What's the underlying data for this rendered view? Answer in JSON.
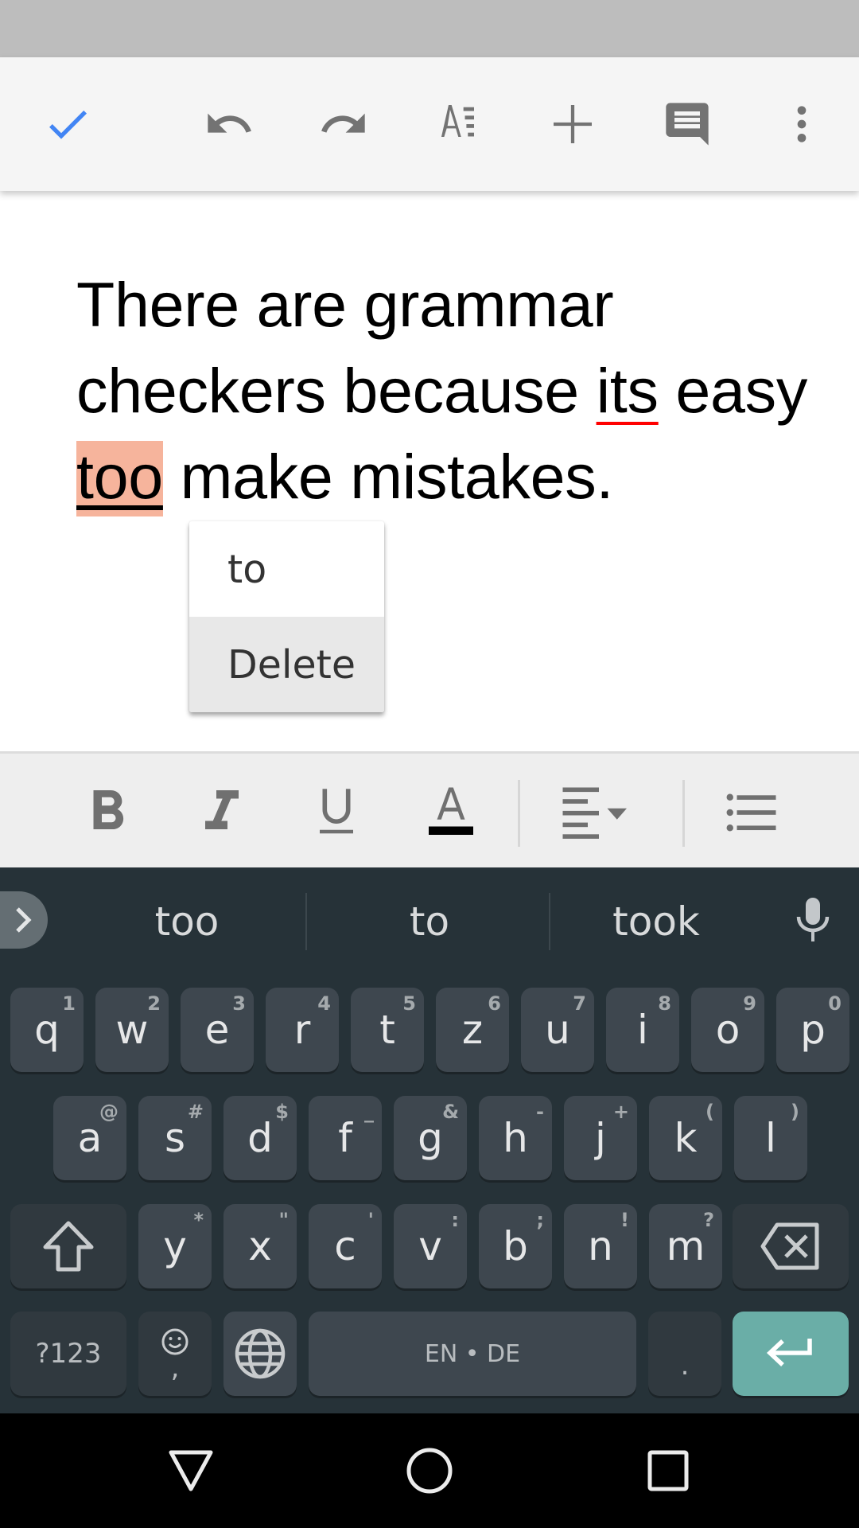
{
  "top_toolbar": {
    "icons": [
      "check-icon",
      "undo-icon",
      "redo-icon",
      "text-format-icon",
      "insert-plus-icon",
      "comment-icon",
      "more-vert-icon"
    ],
    "accent_color": "#4285f4",
    "icon_color": "#737373"
  },
  "document": {
    "text_before": "There are grammar checkers because ",
    "spell_error_word": "its",
    "text_middle": " easy ",
    "grammar_error_word": "too",
    "text_after": " make mistakes.",
    "highlight_color": "#f6b49c",
    "spell_underline_color": "#ff0000"
  },
  "suggestion_popup": {
    "items": [
      {
        "label": "to"
      },
      {
        "label": "Delete"
      }
    ]
  },
  "format_toolbar": {
    "icons": [
      "bold-icon",
      "italic-icon",
      "underline-icon",
      "text-color-icon",
      "align-left-icon",
      "bulleted-list-icon"
    ],
    "text_color_swatch": "#000000"
  },
  "keyboard": {
    "suggestions": [
      "too",
      "to",
      "took"
    ],
    "rows": [
      [
        {
          "k": "q",
          "h": "1"
        },
        {
          "k": "w",
          "h": "2"
        },
        {
          "k": "e",
          "h": "3"
        },
        {
          "k": "r",
          "h": "4"
        },
        {
          "k": "t",
          "h": "5"
        },
        {
          "k": "z",
          "h": "6"
        },
        {
          "k": "u",
          "h": "7"
        },
        {
          "k": "i",
          "h": "8"
        },
        {
          "k": "o",
          "h": "9"
        },
        {
          "k": "p",
          "h": "0"
        }
      ],
      [
        {
          "k": "a",
          "h": "@"
        },
        {
          "k": "s",
          "h": "#"
        },
        {
          "k": "d",
          "h": "$"
        },
        {
          "k": "f",
          "h": "_"
        },
        {
          "k": "g",
          "h": "&"
        },
        {
          "k": "h",
          "h": "-"
        },
        {
          "k": "j",
          "h": "+"
        },
        {
          "k": "k",
          "h": "("
        },
        {
          "k": "l",
          "h": ")"
        }
      ],
      [
        {
          "k": "y",
          "h": "*"
        },
        {
          "k": "x",
          "h": "\""
        },
        {
          "k": "c",
          "h": "'"
        },
        {
          "k": "v",
          "h": ":"
        },
        {
          "k": "b",
          "h": ";"
        },
        {
          "k": "n",
          "h": "!"
        },
        {
          "k": "m",
          "h": "?"
        }
      ]
    ],
    "symbols_label": "?123",
    "comma_label": ",",
    "space_label": "EN • DE",
    "period_label": ".",
    "enter_color": "#6aaea7"
  },
  "nav_bar": {
    "icons": [
      "back-icon",
      "home-icon",
      "recents-icon"
    ]
  }
}
